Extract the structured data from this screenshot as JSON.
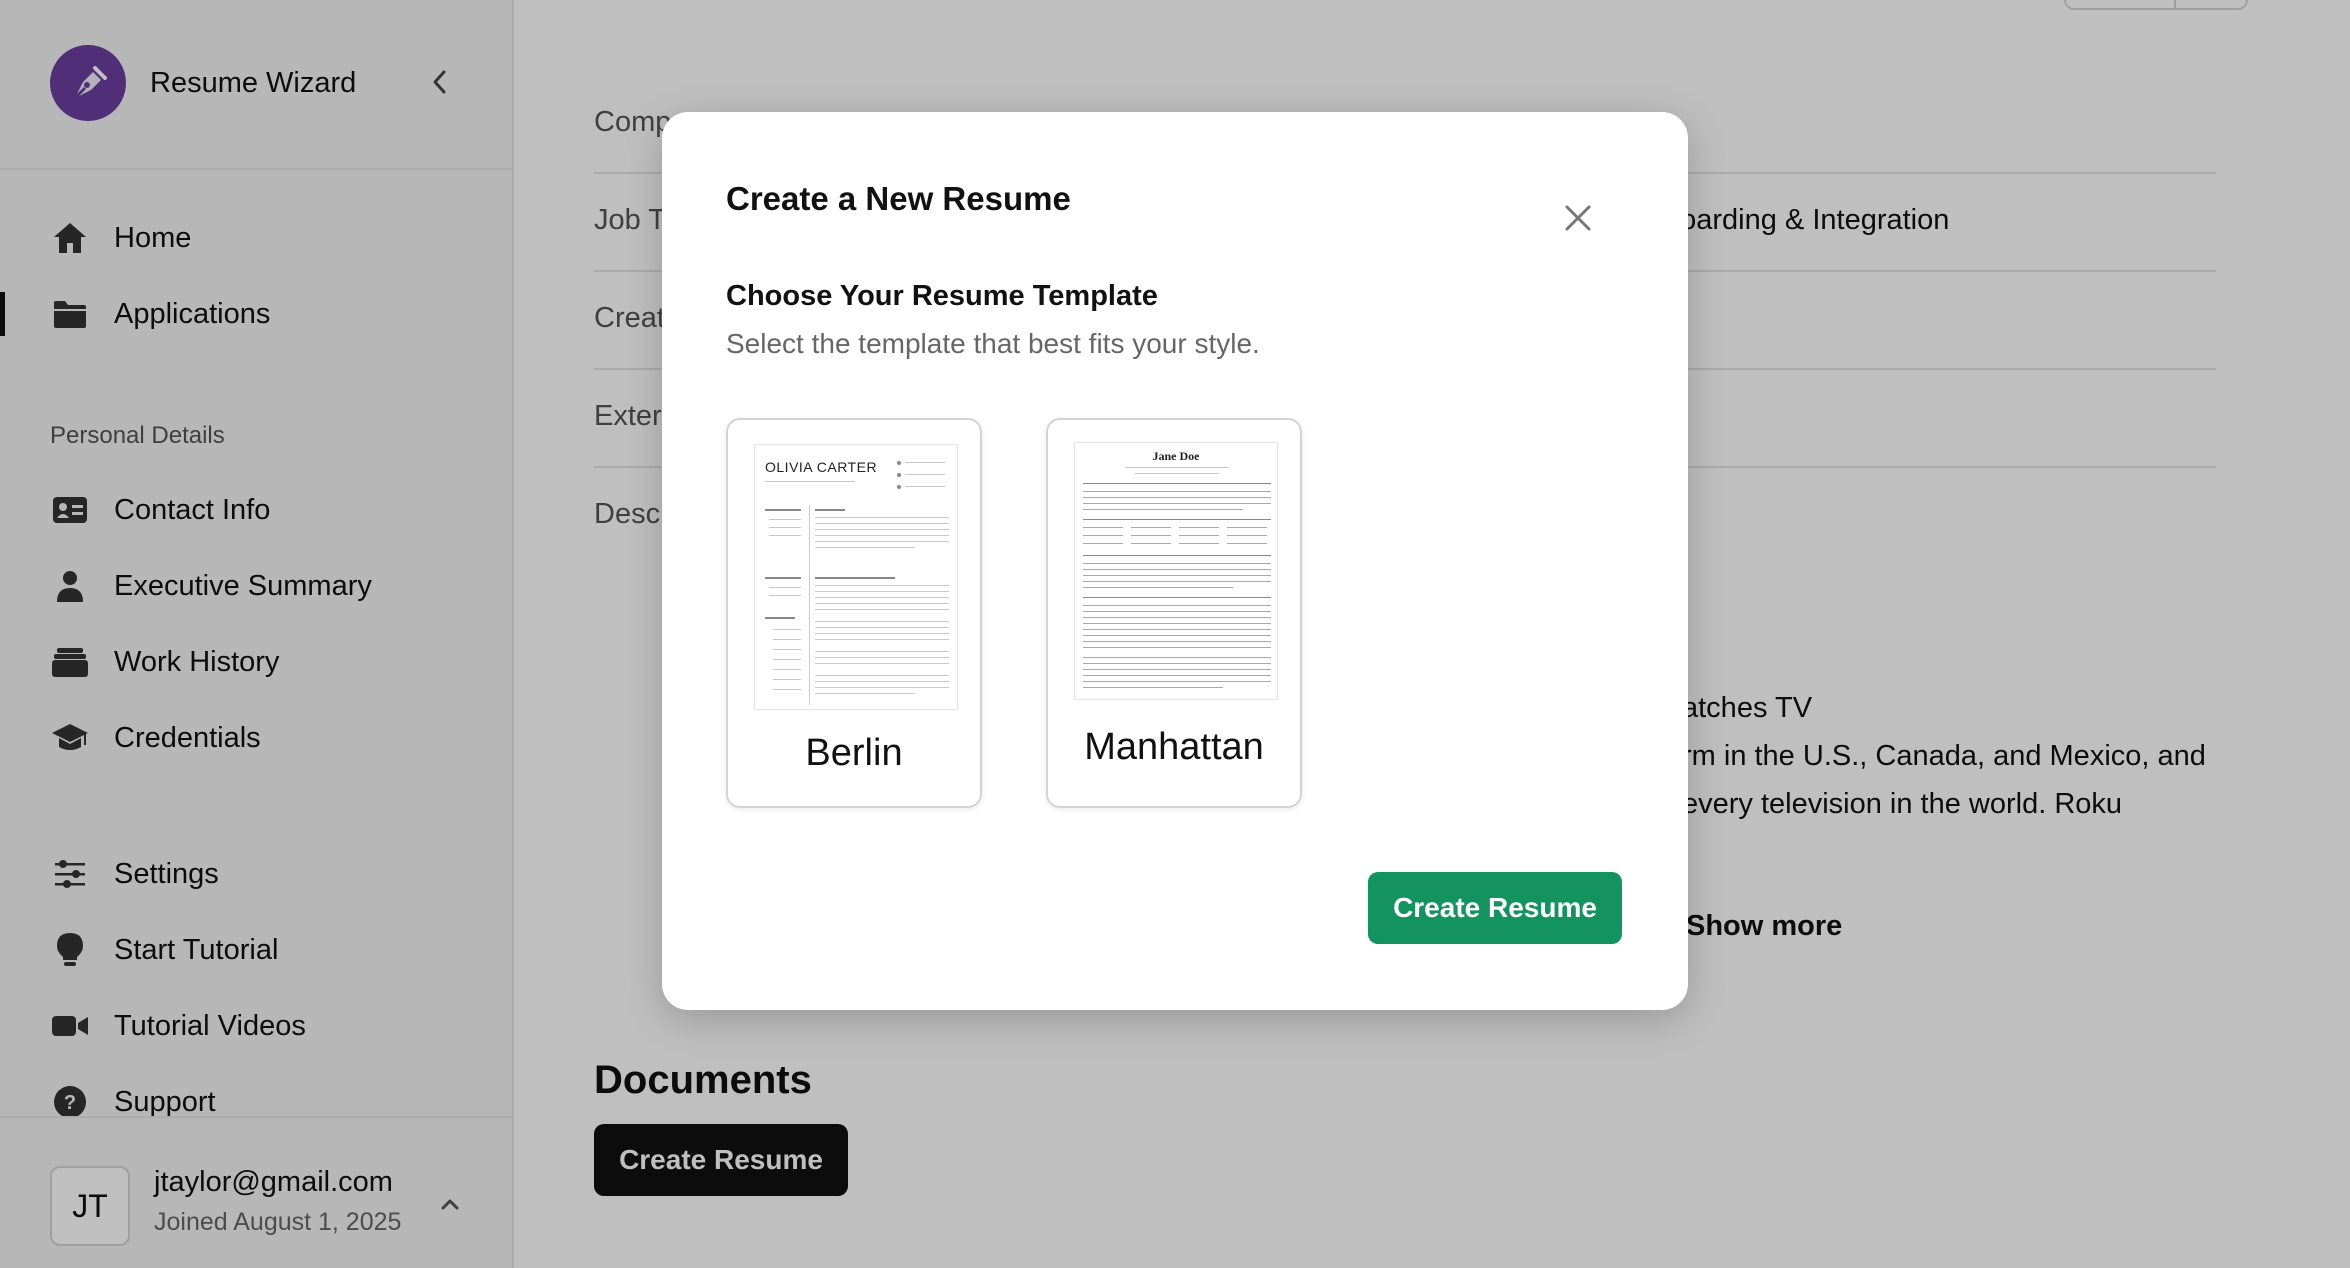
{
  "app": {
    "name": "Resume Wizard"
  },
  "sidebar": {
    "primary": [
      {
        "label": "Home",
        "icon": "home-icon"
      },
      {
        "label": "Applications",
        "icon": "folder-icon"
      }
    ],
    "section_label": "Personal Details",
    "personal": [
      {
        "label": "Contact Info",
        "icon": "contact-card-icon"
      },
      {
        "label": "Executive Summary",
        "icon": "person-icon"
      },
      {
        "label": "Work History",
        "icon": "briefcase-stack-icon"
      },
      {
        "label": "Credentials",
        "icon": "graduation-cap-icon"
      }
    ],
    "utility": [
      {
        "label": "Settings",
        "icon": "sliders-icon"
      },
      {
        "label": "Start Tutorial",
        "icon": "lightbulb-icon"
      },
      {
        "label": "Tutorial Videos",
        "icon": "video-camera-icon"
      },
      {
        "label": "Support",
        "icon": "help-circle-icon"
      }
    ],
    "user": {
      "initials": "JT",
      "email": "jtaylor@gmail.com",
      "joined": "Joined August 1, 2025"
    }
  },
  "main": {
    "fields": [
      {
        "label": "Comp",
        "value": ""
      },
      {
        "label": "Job T",
        "value": "boarding & Integration"
      },
      {
        "label": "Creat",
        "value": ""
      },
      {
        "label": "Exter",
        "value": ""
      },
      {
        "label": "Desc",
        "value": ""
      }
    ],
    "description_lines": [
      ".",
      "atches TV",
      "rm in the U.S., Canada, and Mexico, and",
      "every television in the world. Roku"
    ],
    "show_more": "Show more",
    "documents_title": "Documents",
    "create_resume_label": "Create Resume"
  },
  "modal": {
    "title": "Create a New Resume",
    "subtitle": "Choose Your Resume Template",
    "description": "Select the template that best fits your style.",
    "templates": [
      {
        "name": "Berlin",
        "preview_name": "OLIVIA CARTER"
      },
      {
        "name": "Manhattan",
        "preview_name": "Jane Doe"
      }
    ],
    "create_button": "Create Resume"
  },
  "colors": {
    "brand": "#6b3fa0",
    "primary_button": "#12935f",
    "dark_button": "#111111"
  }
}
